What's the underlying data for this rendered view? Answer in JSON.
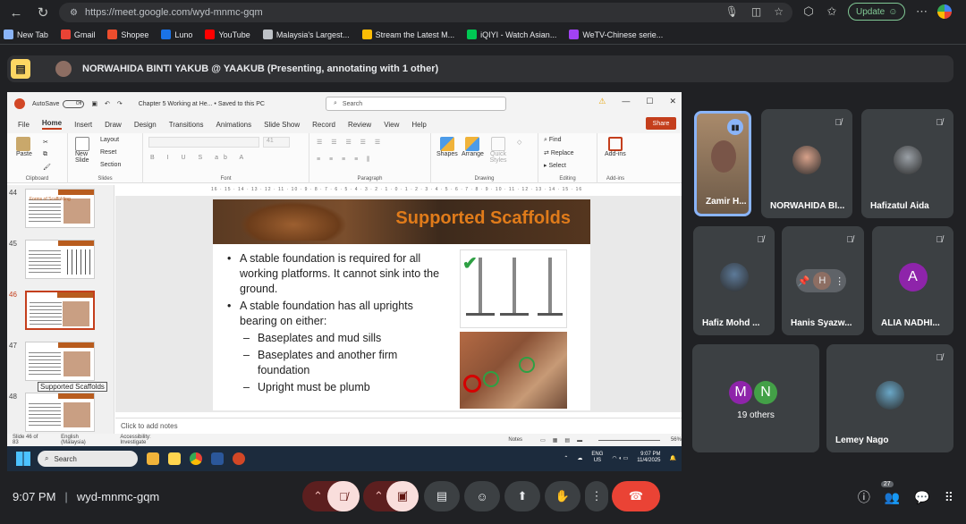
{
  "browser": {
    "url": "https://meet.google.com/wyd-mnmc-gqm",
    "update_label": "Update",
    "bookmarks": [
      {
        "label": "New Tab",
        "color": "#8ab4f8"
      },
      {
        "label": "Gmail",
        "color": "#ea4335"
      },
      {
        "label": "Shopee",
        "color": "#ee4d2d"
      },
      {
        "label": "Luno",
        "color": "#1a73e8"
      },
      {
        "label": "YouTube",
        "color": "#ff0000"
      },
      {
        "label": "Malaysia's Largest...",
        "color": "#bdc1c6"
      },
      {
        "label": "Stream the Latest M...",
        "color": "#fbbc05"
      },
      {
        "label": "iQIYI - Watch Asian...",
        "color": "#00c853"
      },
      {
        "label": "WeTV-Chinese serie...",
        "color": "#a142f4"
      }
    ]
  },
  "presenter": {
    "text": "NORWAHIDA BINTI YAKUB @ YAAKUB (Presenting, annotating with 1 other)"
  },
  "powerpoint": {
    "autosave": "AutoSave",
    "autosave_state": "Off",
    "doc_title": "Chapter 5 Working at He...  •  Saved to this PC",
    "search_placeholder": "Search",
    "tabs": [
      "File",
      "Home",
      "Insert",
      "Draw",
      "Design",
      "Transitions",
      "Animations",
      "Slide Show",
      "Record",
      "Review",
      "View",
      "Help"
    ],
    "share_label": "Share",
    "ribbon": {
      "clipboard": "Clipboard",
      "paste": "Paste",
      "slides": "Slides",
      "new_slide": "New Slide",
      "layout": "Layout",
      "reset": "Reset",
      "section": "Section",
      "font": "Font",
      "font_size": "41",
      "paragraph": "Paragraph",
      "drawing": "Drawing",
      "shapes": "Shapes",
      "arrange": "Arrange",
      "quick_styles": "Quick Styles",
      "editing": "Editing",
      "find": "Find",
      "replace": "Replace",
      "select": "Select",
      "addins": "Add-ins",
      "addins_btn": "Add-ins"
    },
    "ruler": "16 · 15 · 14 · 13 · 12 · 11 · 10 · 9 · 8 · 7 · 6 · 5 · 4 · 3 · 2 · 1 · 0 · 1 · 2 · 3 · 4 · 5 · 6 · 7 · 8 · 9 · 10 · 11 · 12 · 13 · 14 · 15 · 16",
    "thumbnails": [
      {
        "num": "44",
        "title": "Forms of Scaffolding"
      },
      {
        "num": "45",
        "title": ""
      },
      {
        "num": "46",
        "title": ""
      },
      {
        "num": "47",
        "title": ""
      },
      {
        "num": "48",
        "title": ""
      }
    ],
    "tooltip": "Supported Scaffolds",
    "slide": {
      "title": "Supported Scaffolds",
      "bullets": [
        {
          "level": 1,
          "text": "A stable foundation is required for all working platforms. It cannot sink into the ground."
        },
        {
          "level": 1,
          "text": "A stable foundation has all uprights bearing on either:"
        },
        {
          "level": 2,
          "text": "Baseplates and mud sills"
        },
        {
          "level": 2,
          "text": "Baseplates and another firm foundation"
        },
        {
          "level": 2,
          "text": "Upright must be plumb"
        }
      ]
    },
    "notes_placeholder": "Click to add notes",
    "status": {
      "slide_count": "Slide 46 of 83",
      "language": "English (Malaysia)",
      "accessibility": "Accessibility: Investigate",
      "notes": "Notes",
      "zoom": "56%"
    },
    "taskbar": {
      "search": "Search",
      "lang": "ENG",
      "region": "US",
      "time": "9:07 PM",
      "date": "11/4/2025"
    }
  },
  "participants": [
    {
      "name": "Zamir H...",
      "active": true,
      "speaking": true,
      "color": "#795548"
    },
    {
      "name": "NORWAHIDA BI...",
      "muted": true,
      "color": "#d7a18a"
    },
    {
      "name": "Hafizatul Aida",
      "muted": true,
      "color": "#9aa0a6"
    },
    {
      "name": "Hafiz Mohd ...",
      "muted": true,
      "color": "#5d7a99"
    },
    {
      "name": "Hanis Syazw...",
      "muted": true,
      "letter": "H",
      "color": "#8d6e63"
    },
    {
      "name": "ALIA NADHI...",
      "muted": true,
      "letter": "A",
      "color": "#8e24aa"
    },
    {
      "name": "19 others",
      "letters": [
        "M",
        "N"
      ],
      "colors": [
        "#8e24aa",
        "#43a047"
      ]
    },
    {
      "name": "Lemey Nago",
      "muted": true,
      "color": "#6aa7c7"
    }
  ],
  "meeting": {
    "time": "9:07 PM",
    "code": "wyd-mnmc-gqm",
    "participant_count": "27"
  }
}
